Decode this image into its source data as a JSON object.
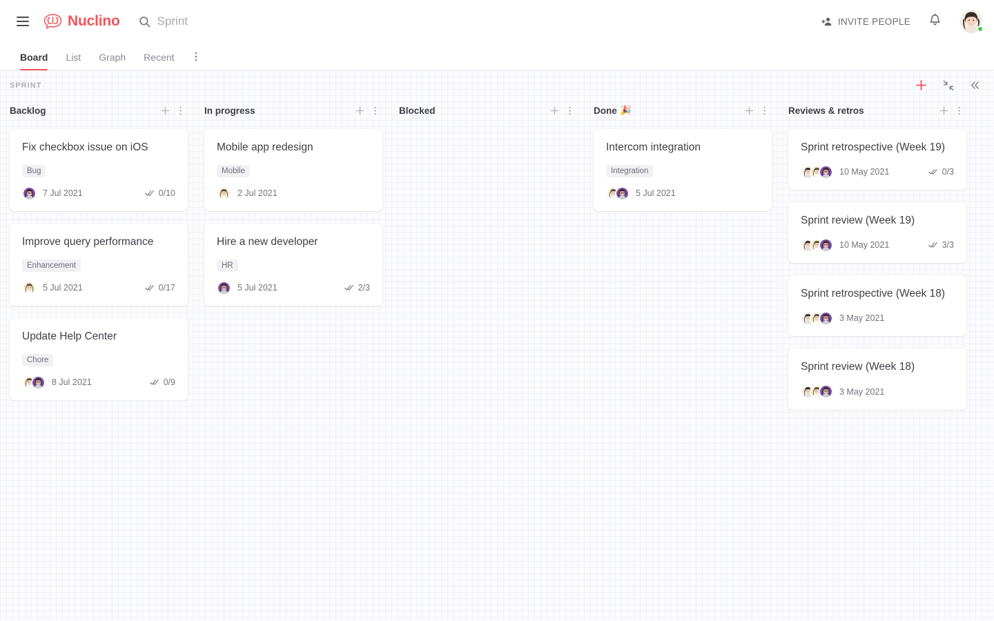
{
  "brand": {
    "name": "Nuclino",
    "color": "#f2545b",
    "logo_icon": "brain-bubble-logo"
  },
  "topbar": {
    "menu_icon": "hamburger-menu-icon",
    "search": {
      "icon": "search-icon",
      "value": "",
      "placeholder": "Sprint"
    },
    "invite": {
      "label": "INVITE PEOPLE",
      "icon": "add-person-icon"
    },
    "notifications_icon": "bell-icon",
    "avatar": {
      "icon": "user-avatar",
      "status": "online",
      "status_color": "#53c653"
    }
  },
  "tabs": {
    "items": [
      {
        "label": "Board",
        "active": true
      },
      {
        "label": "List",
        "active": false
      },
      {
        "label": "Graph",
        "active": false
      },
      {
        "label": "Recent",
        "active": false
      }
    ],
    "more_icon": "kebab-menu-icon"
  },
  "board": {
    "breadcrumb": "SPRINT",
    "actions": [
      {
        "name": "add-item-button",
        "icon": "plus-icon",
        "color": "#f2545b"
      },
      {
        "name": "collapse-all-button",
        "icon": "collapse-inward-icon"
      },
      {
        "name": "collapse-sidebar-button",
        "icon": "double-chevron-left-icon"
      }
    ],
    "column_add_icon": "plus-icon",
    "column_more_icon": "kebab-menu-icon",
    "checklist_icon": "double-check-icon",
    "columns": [
      {
        "title": "Backlog",
        "emoji": "",
        "cards": [
          {
            "title": "Fix checkbox issue on iOS",
            "tag": "Bug",
            "date": "7 Jul 2021",
            "checks": "0/10",
            "avatars": [
              "purple-woman-glasses"
            ]
          },
          {
            "title": "Improve query performance",
            "tag": "Enhancement",
            "date": "5 Jul 2021",
            "checks": "0/17",
            "avatars": [
              "cream-man"
            ]
          },
          {
            "title": "Update Help Center",
            "tag": "Chore",
            "date": "8 Jul 2021",
            "checks": "0/9",
            "avatars": [
              "cream-man",
              "purple-woman-glasses"
            ]
          }
        ]
      },
      {
        "title": "In progress",
        "emoji": "",
        "cards": [
          {
            "title": "Mobile app redesign",
            "tag": "Mobile",
            "date": "2 Jul 2021",
            "checks": "",
            "avatars": [
              "cream-man"
            ]
          },
          {
            "title": "Hire a new developer",
            "tag": "HR",
            "date": "5 Jul 2021",
            "checks": "2/3",
            "avatars": [
              "purple-woman-glasses"
            ]
          }
        ]
      },
      {
        "title": "Blocked",
        "emoji": "",
        "cards": []
      },
      {
        "title": "Done",
        "emoji": "🎉",
        "cards": [
          {
            "title": "Intercom integration",
            "tag": "Integration",
            "date": "5 Jul 2021",
            "checks": "",
            "avatars": [
              "cream-man",
              "purple-woman-glasses"
            ]
          }
        ]
      },
      {
        "title": "Reviews & retros",
        "emoji": "",
        "cards": [
          {
            "title": "Sprint retrospective (Week 19)",
            "tag": "",
            "date": "10 May 2021",
            "checks": "0/3",
            "avatars": [
              "dark-hair-woman",
              "cream-man",
              "purple-woman-glasses"
            ]
          },
          {
            "title": "Sprint review (Week 19)",
            "tag": "",
            "date": "10 May 2021",
            "checks": "3/3",
            "avatars": [
              "dark-hair-woman",
              "cream-man",
              "purple-woman-glasses"
            ]
          },
          {
            "title": "Sprint retrospective (Week 18)",
            "tag": "",
            "date": "3 May 2021",
            "checks": "",
            "avatars": [
              "dark-hair-woman",
              "cream-man",
              "purple-woman-glasses"
            ]
          },
          {
            "title": "Sprint review (Week 18)",
            "tag": "",
            "date": "3 May 2021",
            "checks": "",
            "avatars": [
              "dark-hair-woman",
              "cream-man",
              "purple-woman-glasses"
            ]
          }
        ]
      }
    ]
  }
}
